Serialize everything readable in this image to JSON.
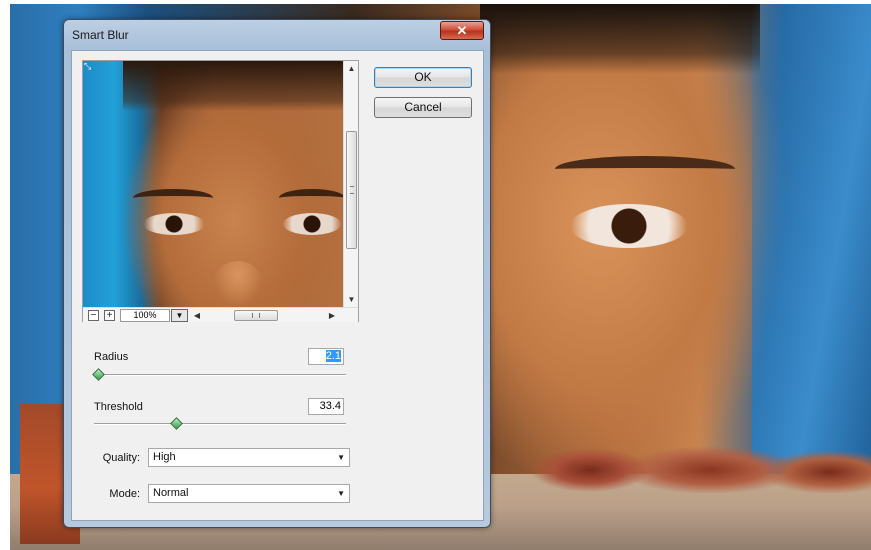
{
  "dialog": {
    "title": "Smart Blur",
    "close_icon": "close-icon",
    "ok_label": "OK",
    "cancel_label": "Cancel"
  },
  "preview": {
    "zoom_out_icon": "−",
    "zoom_in_icon": "+",
    "zoom_level": "100%"
  },
  "radius": {
    "label": "Radius",
    "value": "2.1",
    "slider_fraction": 0.02
  },
  "threshold": {
    "label": "Threshold",
    "value": "33.4",
    "slider_fraction": 0.33
  },
  "quality": {
    "label": "Quality:",
    "value": "High"
  },
  "mode": {
    "label": "Mode:",
    "value": "Normal"
  },
  "colors": {
    "titlebar": "#bccfe4",
    "client_bg": "#f0f0f0",
    "close_red": "#d0503a",
    "selection": "#3399ff",
    "slider_thumb": "#3c9a4a"
  }
}
